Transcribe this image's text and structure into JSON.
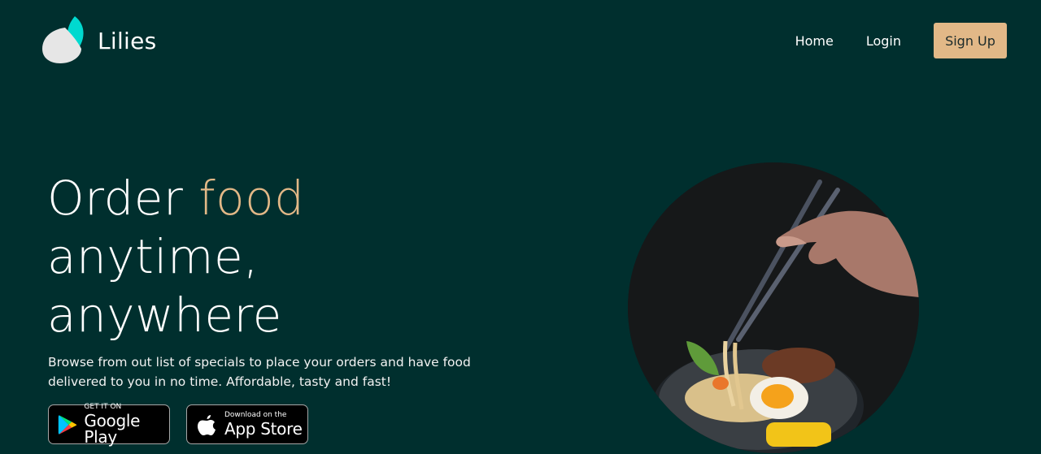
{
  "brand": {
    "name": "Lilies"
  },
  "nav": {
    "home": "Home",
    "login": "Login",
    "signup": "Sign Up"
  },
  "hero": {
    "title_part1": "Order ",
    "title_accent": "food",
    "title_line2": "anytime,",
    "title_line3": "anywhere",
    "description": "Browse from out list of specials to place your orders and have food delivered to you in no time. Affordable, tasty and fast!"
  },
  "stores": {
    "google": {
      "small": "GET IT ON",
      "big": "Google Play",
      "icon": "google-play-icon"
    },
    "apple": {
      "small": "Download on the",
      "big": "App Store",
      "icon": "apple-icon"
    }
  },
  "colors": {
    "background": "#002f2e",
    "accent": "#e2b887",
    "logo_teal": "#00d9cf",
    "logo_light": "#e6e6e6"
  }
}
